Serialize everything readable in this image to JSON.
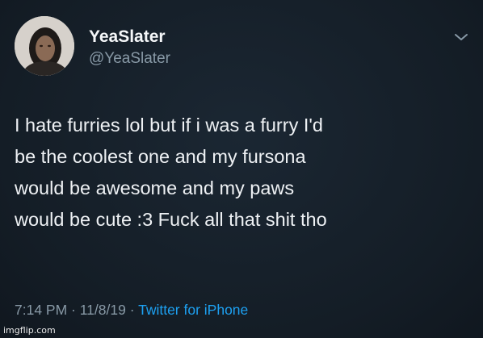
{
  "user": {
    "display_name": "YeaSlater",
    "handle": "@YeaSlater",
    "avatar_icon": "profile-photo"
  },
  "menu_icon": "chevron-down-icon",
  "tweet": {
    "lines": [
      "I hate furries lol but if i was a furry I'd",
      "be the coolest one and my fursona",
      "would be awesome and my paws",
      "would be cute :3 Fuck all that shit tho"
    ]
  },
  "meta": {
    "time": "7:14 PM",
    "separator1": " · ",
    "date": "11/8/19",
    "separator2": " · ",
    "source": "Twitter for iPhone"
  },
  "watermark": "imgflip.com",
  "colors": {
    "background": "#141d26",
    "secondary_text": "#8899a6",
    "link": "#1da1f2"
  }
}
